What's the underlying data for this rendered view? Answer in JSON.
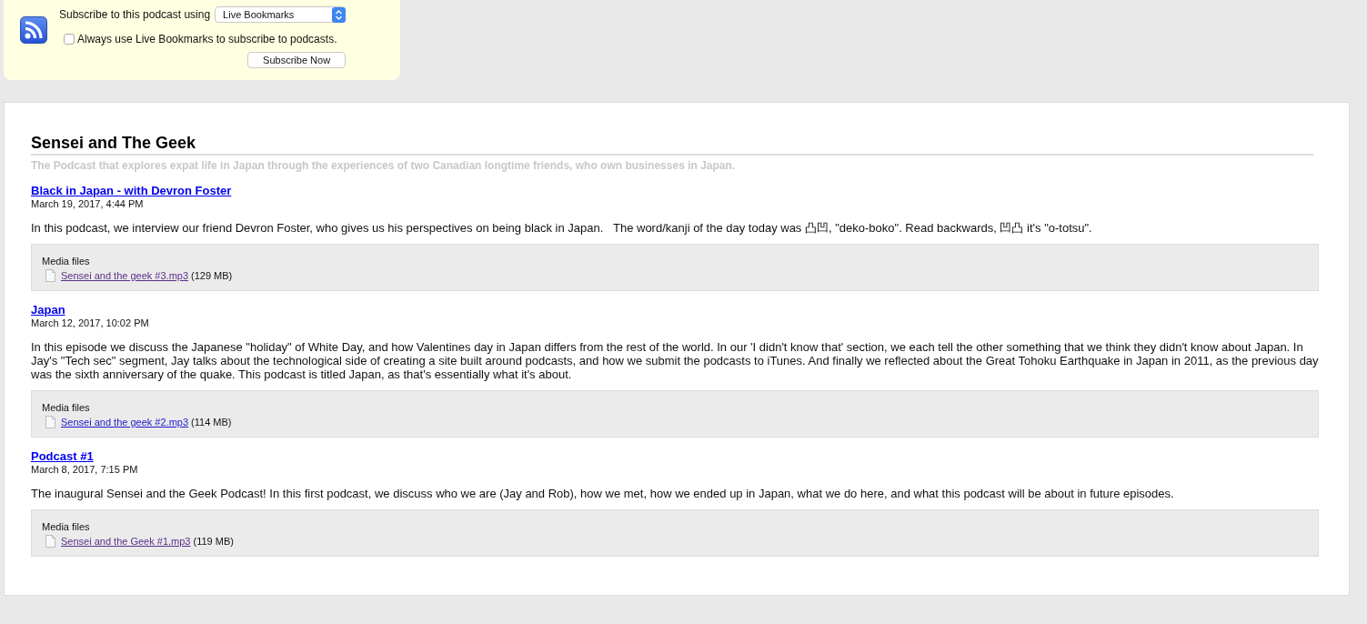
{
  "subscribe": {
    "label": "Subscribe to this podcast using",
    "reader": "Live Bookmarks",
    "always_use": {
      "label": "Always use Live Bookmarks to subscribe to podcasts.",
      "checked": false
    },
    "button": "Subscribe Now"
  },
  "feed": {
    "title": "Sensei and The Geek",
    "subtitle": "The Podcast that explores expat life in Japan through the experiences of two Canadian longtime friends, who own businesses in Japan."
  },
  "entries": [
    {
      "title": "Black in Japan - with Devron Foster",
      "date": "March 19, 2017, 4:44 PM",
      "description": "In this podcast, we interview our friend Devron Foster, who gives us his perspectives on being black in Japan.   The word/kanji of the day today was 凸凹, \"deko-boko\". Read backwards, 凹凸 it's \"o-totsu\".",
      "media": {
        "heading": "Media files",
        "files": [
          {
            "name": "Sensei and the geek #3.mp3",
            "size": "(129 MB)",
            "visited": true
          }
        ]
      }
    },
    {
      "title": "Japan",
      "date": "March 12, 2017, 10:02 PM",
      "description": "In this episode we discuss the Japanese \"holiday\" of White Day, and how Valentines day in Japan differs from the rest of the world. In our 'I didn't know that' section, we each tell the other something that we think they didn't know about Japan. In Jay's \"Tech sec\" segment, Jay talks about the technological side of creating a site built around podcasts, and how we submit the podcasts to iTunes. And finally we reflected about the Great Tohoku Earthquake in Japan in 2011, as the previous day was the sixth anniversary of the quake. This podcast is titled Japan, as that's essentially what it's about.",
      "media": {
        "heading": "Media files",
        "files": [
          {
            "name": "Sensei and the geek #2.mp3",
            "size": "(114 MB)",
            "visited": false
          }
        ]
      }
    },
    {
      "title": "Podcast #1",
      "date": "March 8, 2017, 7:15 PM",
      "description": "The inaugural Sensei and the Geek Podcast! In this first podcast, we discuss who we are (Jay and Rob), how we met, how we ended up in Japan, what we do here, and what this podcast will be about in future episodes.",
      "media": {
        "heading": "Media files",
        "files": [
          {
            "name": "Sensei and the Geek #1.mp3",
            "size": "(119 MB)",
            "visited": true
          }
        ]
      }
    }
  ]
}
